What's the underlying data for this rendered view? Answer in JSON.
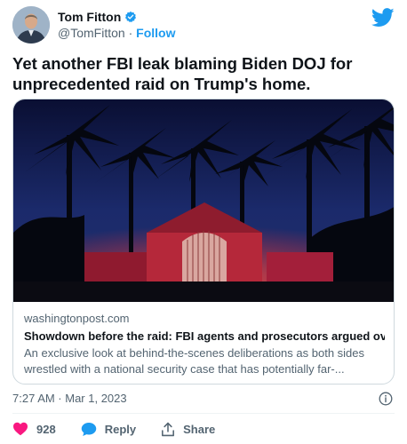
{
  "author": {
    "name": "Tom Fitton",
    "handle": "@TomFitton",
    "separator": "·",
    "follow_label": "Follow"
  },
  "tweet": {
    "text": "Yet another FBI leak blaming  Biden DOJ for unprecedented raid on Trump's home."
  },
  "card": {
    "domain": "washingtonpost.com",
    "title": "Showdown before the raid: FBI agents and prosecutors argued ove...",
    "description": "An exclusive look at behind-the-scenes deliberations as both sides wrestled with a national security case that has potentially far-..."
  },
  "timestamp": "7:27 AM · Mar 1, 2023",
  "actions": {
    "like_count": "928",
    "reply_label": "Reply",
    "share_label": "Share"
  },
  "colors": {
    "accent": "#1d9bf0",
    "like": "#f91880",
    "secondary_text": "#536471"
  },
  "icons": [
    "verified-badge-icon",
    "twitter-bird-icon",
    "info-icon",
    "heart-icon",
    "reply-bubble-icon",
    "share-icon"
  ]
}
